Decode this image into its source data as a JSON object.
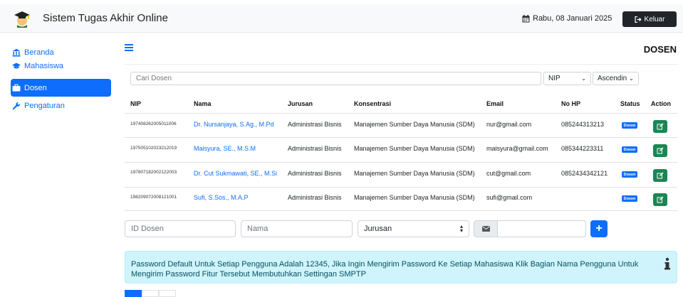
{
  "app": {
    "title": "Sistem Tugas Akhir Online",
    "date": "Rabu, 08 Januari 2025",
    "logout_label": "Keluar"
  },
  "sidebar": {
    "items": [
      {
        "label": "Beranda",
        "icon": "bank-icon",
        "active": false
      },
      {
        "label": "Mahasiswa",
        "icon": "graduation-cap-icon",
        "active": false
      },
      {
        "label": "Dosen",
        "icon": "briefcase-icon",
        "active": true
      },
      {
        "label": "Pengaturan",
        "icon": "wrench-icon",
        "active": false
      }
    ]
  },
  "page": {
    "title": "DOSEN"
  },
  "filters": {
    "search_placeholder": "Cari Dosen",
    "sort_field": "NIP",
    "sort_order": "Ascendin"
  },
  "table": {
    "headers": [
      "NIP",
      "Nama",
      "Jurusan",
      "Konsentrasi",
      "Email",
      "No HP",
      "Status",
      "Action"
    ],
    "rows": [
      {
        "nip": "197408262005011006",
        "nama": "Dr. Nursanjaya, S.Ag., M.Pd",
        "jurusan": "Administrasi Bisnis",
        "konsentrasi": "Manajemen Sumber Daya Manusia (SDM)",
        "email": "nur@gmail.com",
        "hp": "085244313213",
        "status": "Dosen"
      },
      {
        "nip": "197505102023212019",
        "nama": "Maisyura, SE., M.S.M",
        "jurusan": "Administrasi Bisnis",
        "konsentrasi": "Manajemen Sumber Daya Manusia (SDM)",
        "email": "maisyura@gmail.com",
        "hp": "085344223311",
        "status": "Dosen"
      },
      {
        "nip": "197807182002122003",
        "nama": "Dr. Cut Sukmawati, SE., M.Si",
        "jurusan": "Administrasi Bisnis",
        "konsentrasi": "Manajemen Sumber Daya Manusia (SDM)",
        "email": "cut@gmail.com",
        "hp": "0852434342121",
        "status": "Dosen"
      },
      {
        "nip": "198209072008121001",
        "nama": "Sufi, S.Sos., M.A.P",
        "jurusan": "Administrasi Bisnis",
        "konsentrasi": "Manajemen Sumber Daya Manusia (SDM)",
        "email": "sufi@gmail.com",
        "hp": "",
        "status": "Dosen"
      }
    ]
  },
  "form": {
    "id_placeholder": "ID Dosen",
    "nama_placeholder": "Nama",
    "jurusan_value": "Jurusan",
    "add_label": "+"
  },
  "alert": {
    "text": "Password Default Untuk Setiap Pengguna Adalah 12345, Jika Ingin Mengirim Password Ke Setiap Mahasiswa Klik Bagian Nama Pengguna Untuk Mengirim Password Fitur Tersebut Membutuhkan Settingan SMPTP"
  },
  "colors": {
    "primary": "#0d6efd",
    "success": "#198754",
    "dark": "#212529",
    "alert_bg": "#cff4fc"
  }
}
